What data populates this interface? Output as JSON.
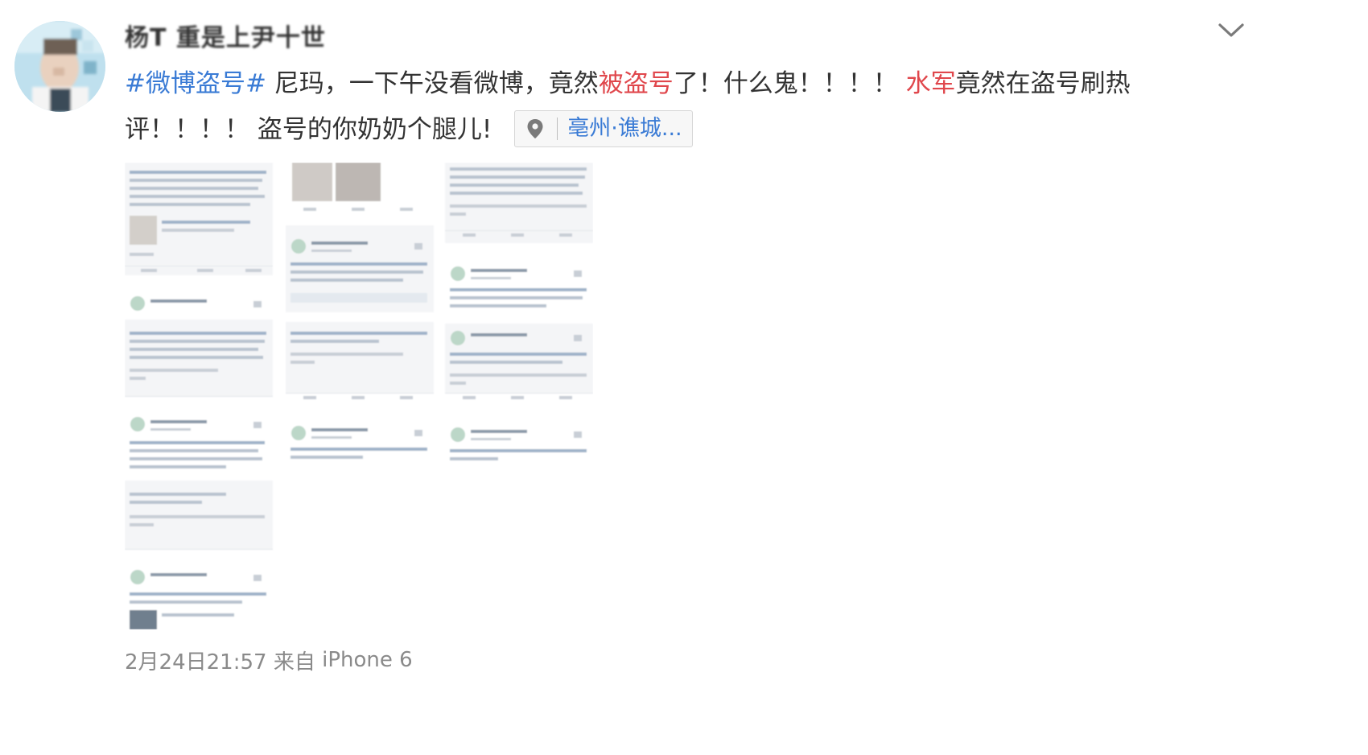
{
  "post": {
    "username": "杨T   重是上尹十世",
    "text": {
      "topic": "#微博盗号#",
      "seg1": " 尼玛，一下午没看微博，竟然",
      "hl1": "被盗号",
      "seg2": "了！什么鬼！！！！ ",
      "hl2": "水军",
      "seg3": "竟然在盗号刷热评！！！！ 盗号的你奶奶个腿儿!"
    },
    "location": "亳州·谯城...",
    "timestamp": "2月24日21:57",
    "source_prefix": "来自",
    "device": "iPhone 6"
  },
  "icons": {
    "avatar": "avatar-photo",
    "more": "chevron-down-icon",
    "location": "map-pin-icon"
  },
  "colors": {
    "topic": "#3a7bd5",
    "highlight": "#e0474c",
    "text": "#333333",
    "meta": "#8a8a8a"
  }
}
